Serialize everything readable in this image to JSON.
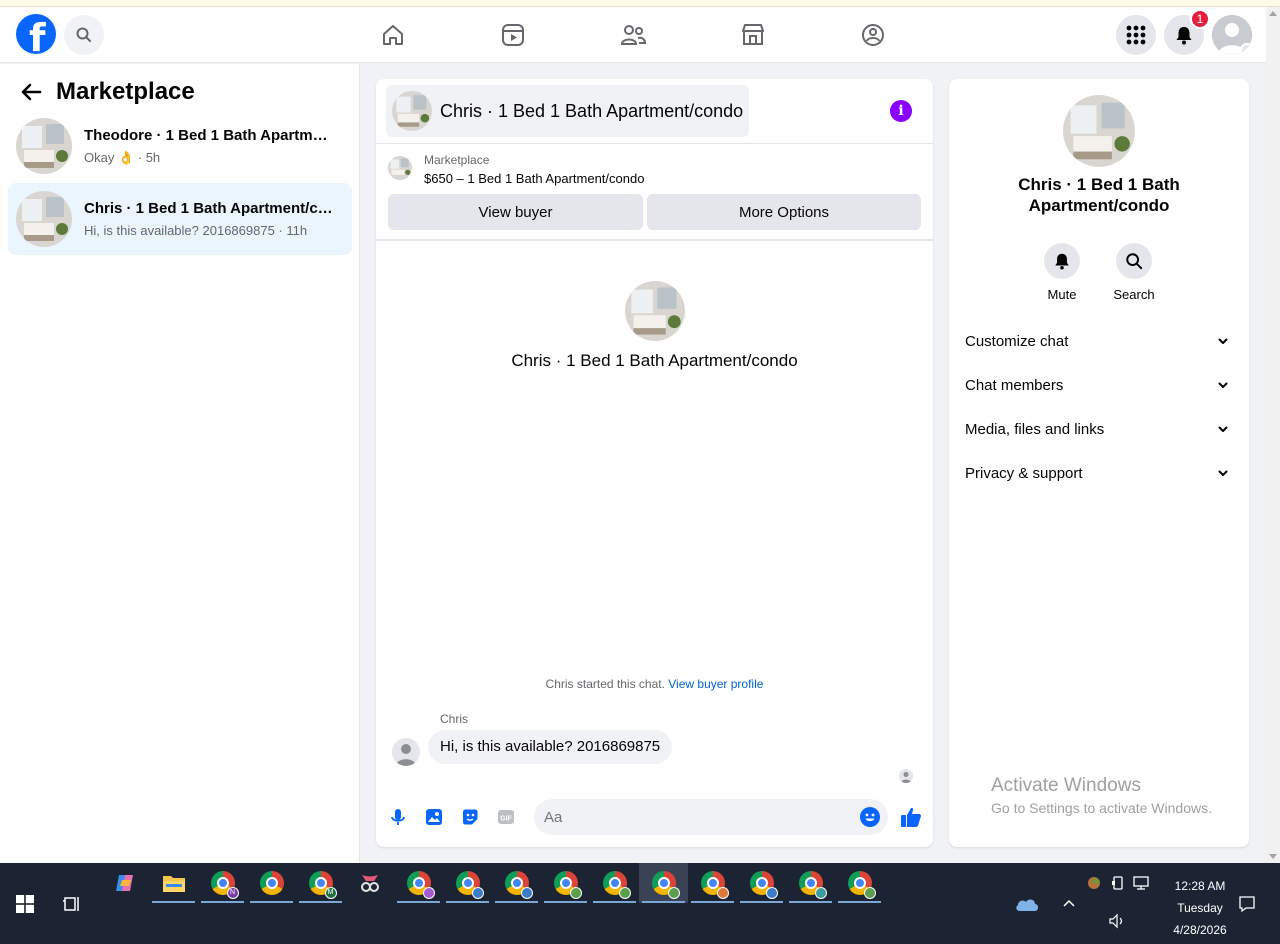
{
  "nav": {
    "logo_letter": "f",
    "notif_count": "1",
    "icons": [
      "home-icon",
      "reels-icon",
      "friends-icon",
      "marketplace-icon",
      "groups-icon"
    ]
  },
  "sidebar": {
    "title": "Marketplace",
    "conversations": [
      {
        "title": "Theodore · 1 Bed 1 Bath Apartment/condo",
        "preview": "Okay 👌 · 5h",
        "active": false
      },
      {
        "title": "Chris · 1 Bed 1 Bath Apartment/condo",
        "preview": "Hi, is this available? 2016869875 · 11h",
        "active": true
      }
    ]
  },
  "chat": {
    "header_title": "Chris · 1 Bed 1 Bath Apartment/condo",
    "info_glyph": "i",
    "marketplace_label": "Marketplace",
    "listing_price": "$650 – 1 Bed 1 Bath Apartment/condo",
    "view_buyer_label": "View buyer",
    "more_options_label": "More Options",
    "center_title": "Chris · 1 Bed 1 Bath Apartment/condo",
    "started_text": "Chris started this chat. ",
    "view_buyer_profile": "View buyer profile",
    "sender_name": "Chris",
    "message_text": "Hi, is this available? 2016869875",
    "composer_placeholder": "Aa"
  },
  "info_panel": {
    "title": "Chris · 1 Bed 1 Bath Apartment/condo",
    "mute_label": "Mute",
    "search_label": "Search",
    "sections": [
      "Customize chat",
      "Chat members",
      "Media, files and links",
      "Privacy & support"
    ]
  },
  "watermark": {
    "line1": "Activate Windows",
    "line2": "Go to Settings to activate Windows."
  },
  "taskbar": {
    "time": "12:28 AM",
    "day": "Tuesday",
    "date": "4/28/2026",
    "profile_badges": [
      "N",
      "",
      "M",
      "",
      "",
      "",
      "",
      "",
      "",
      "",
      "",
      "",
      "",
      ""
    ]
  },
  "colors": {
    "brand": "#0866ff",
    "active_conv": "#ebf5ff",
    "info_purple": "#8a00ff",
    "link": "#0064d1",
    "badge_red": "#e41e3f",
    "taskbar": "#1c2434"
  }
}
